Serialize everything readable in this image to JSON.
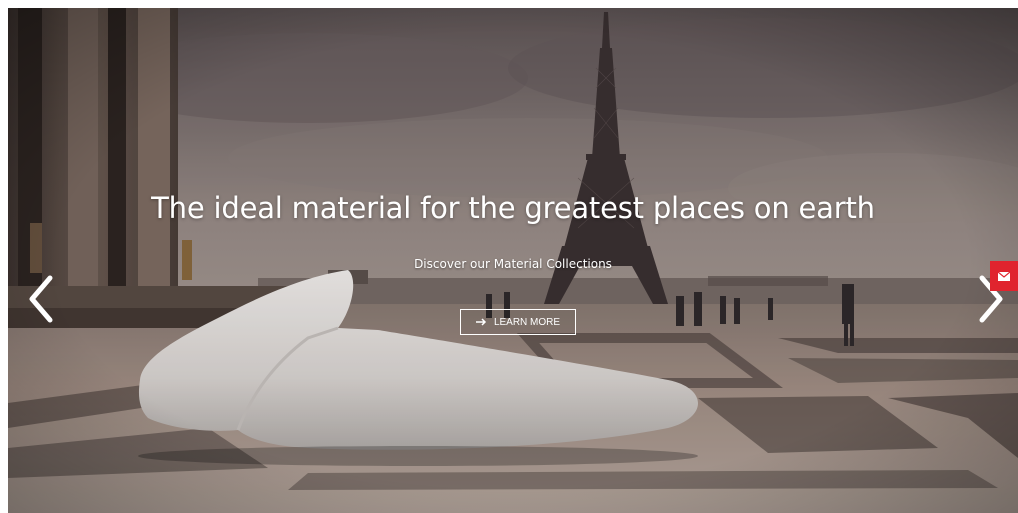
{
  "hero": {
    "headline": "The ideal material for the greatest places on earth",
    "subheadline": "Discover our Material Collections",
    "cta_label": "LEARN MORE"
  },
  "icons": {
    "cta": "arrow-right-icon",
    "prev": "chevron-left-icon",
    "next": "chevron-right-icon",
    "contact": "envelope-icon"
  },
  "colors": {
    "accent": "#e0242e",
    "text": "#ffffff"
  }
}
